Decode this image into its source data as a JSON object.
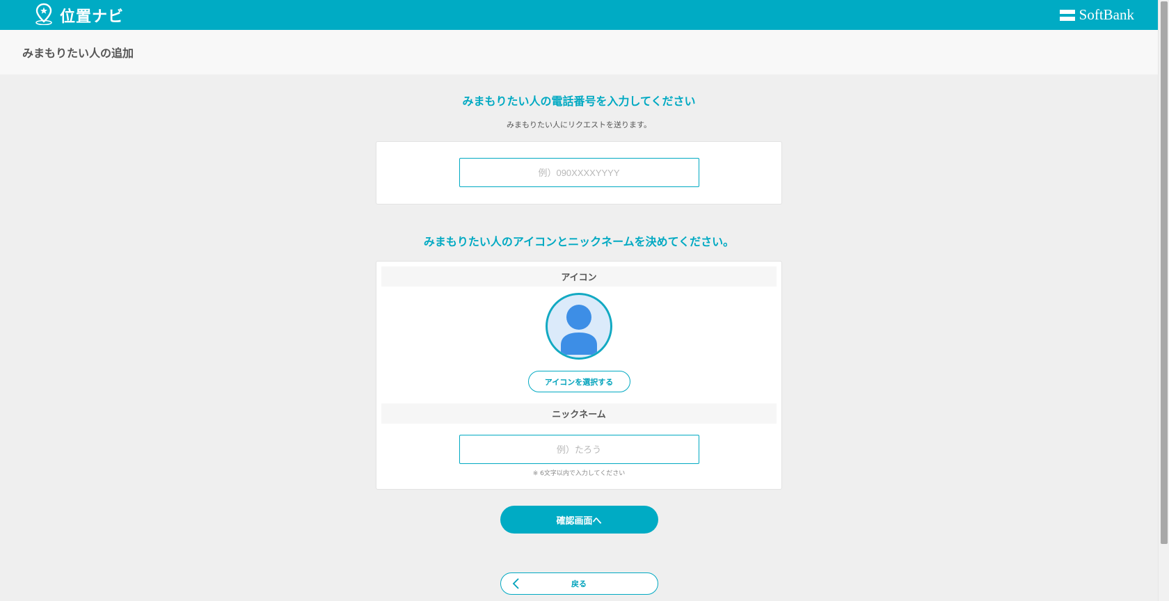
{
  "header": {
    "app_name": "位置ナビ",
    "brand_logo_text": "SoftBank",
    "app_icon": "location-pin-star-icon",
    "brand_color": "#00abc4"
  },
  "page": {
    "title": "みまもりたい人の追加"
  },
  "phone_section": {
    "heading": "みまもりたい人の電話番号を入力してください",
    "subtext": "みまもりたい人にリクエストを送ります。",
    "phone_placeholder": "例）090XXXXYYYY",
    "phone_value": ""
  },
  "profile_section": {
    "heading": "みまもりたい人のアイコンとニックネームを決めてください。",
    "icon_label": "アイコン",
    "avatar_icon": "user-silhouette-icon",
    "select_icon_button": "アイコンを選択する",
    "nickname_label": "ニックネーム",
    "nickname_placeholder": "例）たろう",
    "nickname_value": "",
    "nickname_note": "※ 6文字以内で入力してください"
  },
  "actions": {
    "confirm_button": "確認画面へ",
    "back_button": "戻る",
    "back_icon": "chevron-left-icon"
  }
}
